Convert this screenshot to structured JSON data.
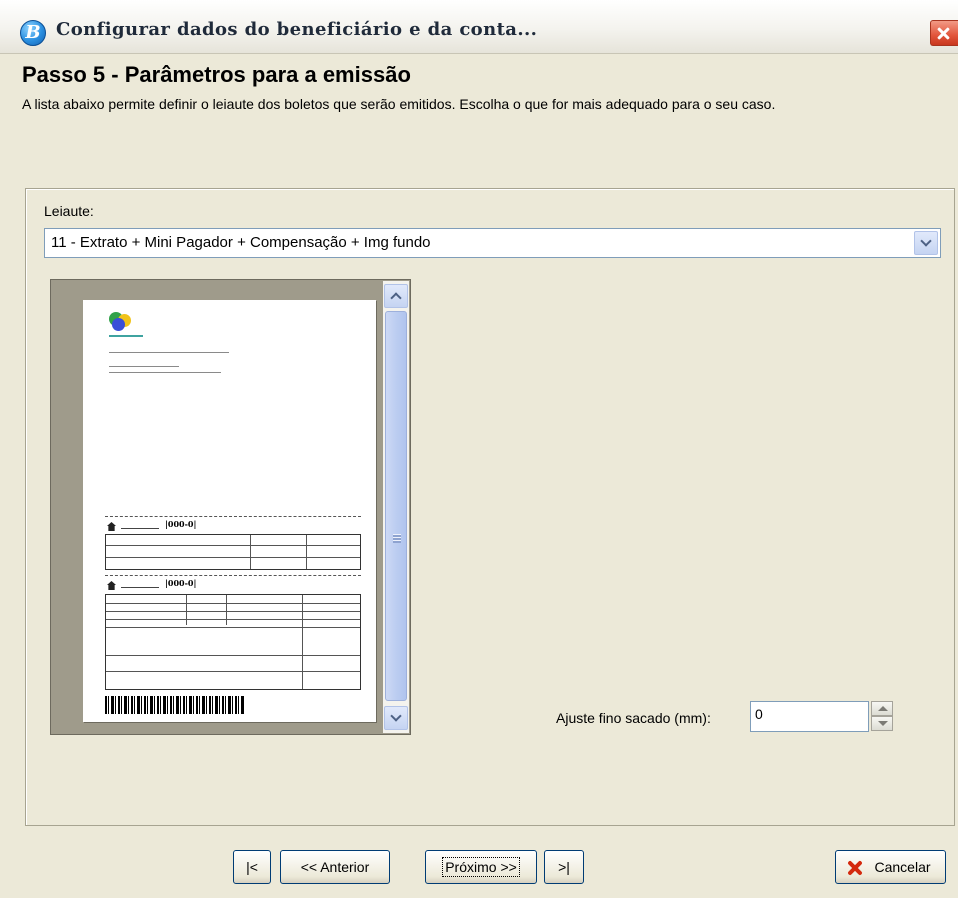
{
  "window": {
    "title": "Configurar dados do beneficiário e da conta...",
    "app_icon_glyph": "B",
    "close_icon": "close-icon"
  },
  "header": {
    "step_title": "Passo 5 - Parâmetros para a emissão",
    "description": "A lista abaixo permite definir o leiaute dos boletos que serão emitidos. Escolha o que for mais adequado para o seu caso."
  },
  "layout": {
    "label": "Leiaute:",
    "selected": "11 - Extrato + Mini Pagador + Compensação + Img fundo"
  },
  "preview": {
    "bank_code_1": "|000-0|",
    "bank_code_2": "|000-0|"
  },
  "fine_adjust": {
    "label": "Ajuste fino sacado (mm):",
    "value": "0"
  },
  "buttons": {
    "first": "|<",
    "previous": "<< Anterior",
    "next": "Próximo >>",
    "last": ">|",
    "cancel": "Cancelar"
  },
  "colors": {
    "window_bg": "#ECE9D8",
    "accent_border": "#003c74",
    "cancel_icon": "#d42a0e"
  }
}
